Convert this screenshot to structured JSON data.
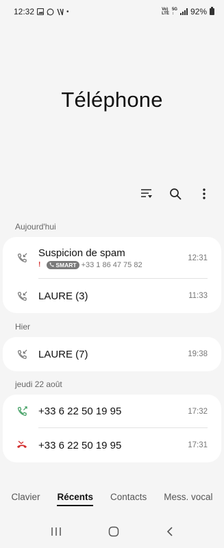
{
  "status_bar": {
    "time": "12:32",
    "dot": "•",
    "net_top": "Vo)",
    "net_bottom": "LTE",
    "gen": "5G",
    "battery": "92%"
  },
  "page_title": "Téléphone",
  "sections": [
    {
      "label": "Aujourd'hui",
      "calls": [
        {
          "name": "Suspicion de spam",
          "excl": "!",
          "smart": "SMART",
          "number": "+33 1 86 47 75 82",
          "time": "12:31",
          "type": "incoming"
        },
        {
          "name": "LAURE (3)",
          "time": "11:33",
          "type": "incoming"
        }
      ]
    },
    {
      "label": "Hier",
      "calls": [
        {
          "name": "LAURE (7)",
          "time": "19:38",
          "type": "incoming"
        }
      ]
    },
    {
      "label": "jeudi 22 août",
      "calls": [
        {
          "name": "+33 6 22 50 19 95",
          "time": "17:32",
          "type": "outgoing"
        },
        {
          "name": "+33 6 22 50 19 95",
          "time": "17:31",
          "type": "missed"
        }
      ]
    }
  ],
  "tabs": [
    {
      "label": "Clavier",
      "active": false
    },
    {
      "label": "Récents",
      "active": true
    },
    {
      "label": "Contacts",
      "active": false
    },
    {
      "label": "Mess. vocal",
      "active": false
    }
  ],
  "colors": {
    "outgoing": "#3a9b5c",
    "missed": "#d32f2f",
    "incoming": "#777777"
  },
  "icons": [
    "filter-icon",
    "search-icon",
    "more-vert-icon",
    "recent-apps-icon",
    "home-icon",
    "back-icon"
  ]
}
